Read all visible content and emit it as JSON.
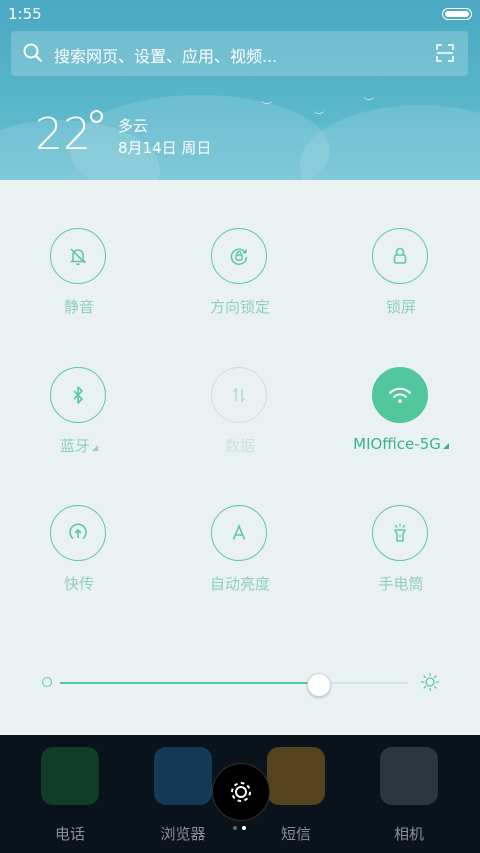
{
  "status_bar": {
    "time": "1:55"
  },
  "search": {
    "placeholder": "搜索网页、设置、应用、视频..."
  },
  "weather": {
    "temperature": "22",
    "condition": "多云",
    "date": "8月14日 周日"
  },
  "quick_settings": {
    "tiles": [
      {
        "label": "静音",
        "icon": "mute-bell-icon",
        "state": "off"
      },
      {
        "label": "方向锁定",
        "icon": "rotation-lock-icon",
        "state": "off"
      },
      {
        "label": "锁屏",
        "icon": "lock-icon",
        "state": "off"
      },
      {
        "label": "蓝牙",
        "icon": "bluetooth-icon",
        "state": "off"
      },
      {
        "label": "数据",
        "icon": "mobile-data-icon",
        "state": "disabled"
      },
      {
        "label": "MIOffice-5G",
        "icon": "wifi-icon",
        "state": "on"
      },
      {
        "label": "快传",
        "icon": "quick-transfer-icon",
        "state": "off"
      },
      {
        "label": "自动亮度",
        "icon": "auto-brightness-icon",
        "state": "off"
      },
      {
        "label": "手电筒",
        "icon": "flashlight-icon",
        "state": "off"
      }
    ]
  },
  "brightness": {
    "level": 0.74
  },
  "dock": {
    "apps": [
      {
        "name": "电话",
        "icon": "phone-icon"
      },
      {
        "name": "浏览器",
        "icon": "browser-icon"
      },
      {
        "name": "短信",
        "icon": "messages-icon"
      },
      {
        "name": "相机",
        "icon": "camera-icon"
      }
    ]
  },
  "colors": {
    "accent": "#52c69c",
    "panel_bg": "#eaf1f3",
    "header_bg": "#58b5ca"
  }
}
